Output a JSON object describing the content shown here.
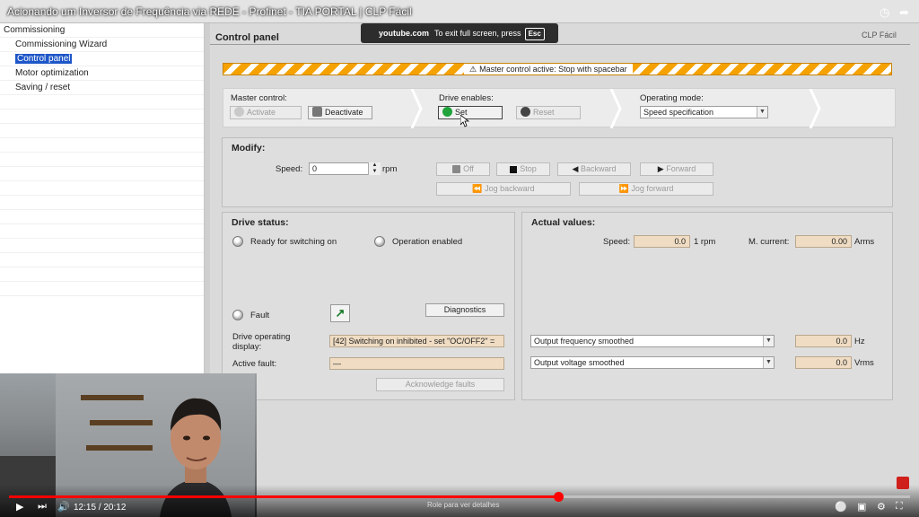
{
  "video": {
    "title": "Acionando um Inversor de Frequência via REDE - Profinet - TIA PORTAL | CLP Fácil",
    "toast_site": "youtube.com",
    "toast_text": "To exit full screen, press",
    "toast_key": "Esc",
    "channel_badge": "CLP Fácil",
    "time": "12:15 / 20:12",
    "scroll_hint": "Role para ver detalhes",
    "progress": 0.61
  },
  "tree": {
    "root": "Commissioning",
    "items": [
      "Commissioning Wizard",
      "Control panel",
      "Motor optimization",
      "Saving / reset"
    ],
    "selected_index": 1
  },
  "panel": {
    "title": "Control panel",
    "banner": "Master control active: Stop with spacebar",
    "master_control": {
      "label": "Master control:",
      "activate": "Activate",
      "deactivate": "Deactivate"
    },
    "drive_enables": {
      "label": "Drive enables:",
      "set": "Set",
      "reset": "Reset"
    },
    "operating_mode": {
      "label": "Operating mode:",
      "value": "Speed specification"
    },
    "modify": {
      "title": "Modify:",
      "speed_label": "Speed:",
      "speed_value": "0",
      "unit": "rpm",
      "off": "Off",
      "stop": "Stop",
      "backward": "Backward",
      "forward": "Forward",
      "jog_backward": "Jog backward",
      "jog_forward": "Jog forward"
    },
    "drive_status": {
      "title": "Drive status:",
      "ready": "Ready for switching on",
      "operation": "Operation enabled",
      "fault": "Fault",
      "diagnostics": "Diagnostics",
      "op_display_label": "Drive operating display:",
      "op_display_value": "[42] Switching on inhibited - set \"OC/OFF2\" =",
      "active_fault_label": "Active fault:",
      "active_fault_value": "—",
      "ack": "Acknowledge faults"
    },
    "actual_values": {
      "title": "Actual values:",
      "speed_label": "Speed:",
      "speed_value": "0.0",
      "speed_unit": "1 rpm",
      "current_label": "M. current:",
      "current_value": "0.00",
      "current_unit": "Arms",
      "sel1": "Output frequency smoothed",
      "val1": "0.0",
      "unit1": "Hz",
      "sel2": "Output voltage smoothed",
      "val2": "0.0",
      "unit2": "Vrms"
    }
  },
  "colors": {
    "accent": "#1e56c8",
    "hazard": "#f5a200",
    "progress": "#ff0000"
  }
}
